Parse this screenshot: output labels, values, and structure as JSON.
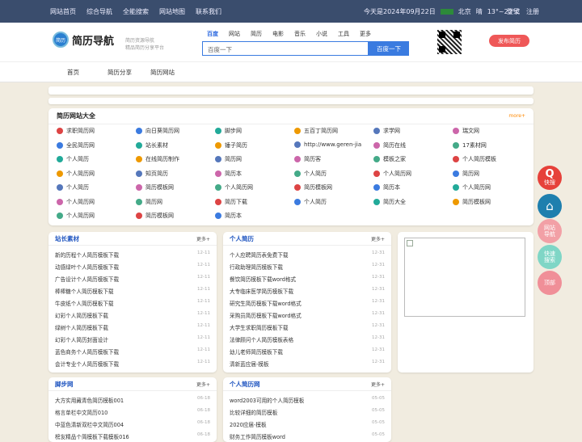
{
  "topbar": {
    "links": [
      "网站首页",
      "综合导航",
      "全能搜索",
      "网站地图",
      "联系我们"
    ],
    "date": "今天是2024年09月22日",
    "city": "北京",
    "weather": "晴",
    "temp": "13°~22°C",
    "login": "登录",
    "register": "注册"
  },
  "header": {
    "logo_icon": "简历",
    "logo_text": "简历导航",
    "slogan1": "简历资源导航",
    "slogan2": "精品简历分享平台",
    "tabs": [
      "百度",
      "网站",
      "简历",
      "电影",
      "音乐",
      "小说",
      "工具",
      "更多"
    ],
    "search_placeholder": "百度一下",
    "search_button": "百度一下",
    "publish": "发布简历"
  },
  "nav": [
    "首页",
    "简历分享",
    "简历网站"
  ],
  "panel": {
    "title": "简历网站大全",
    "more": "more+",
    "rows": [
      [
        "求职简历网",
        "向日葵简历网",
        "脚步网",
        "五百丁简历网",
        "求学网",
        "瑞文网"
      ],
      [
        "全民简历网",
        "站长素材",
        "锤子简历",
        "http://www.geren-jia",
        "简历在线",
        "17素材网"
      ],
      [
        "个人简历",
        "在线简历制作",
        "简历网",
        "简历客",
        "模板之家",
        "个人简历模板"
      ],
      [
        "个人简历网",
        "知页简历",
        "简历本",
        "个人简历",
        "个人简历网",
        "简历网"
      ],
      [
        "个人简历",
        "简历模板网",
        "个人简历网",
        "简历模板网",
        "简历本",
        "个人简历网"
      ],
      [
        "个人简历网",
        "简历网",
        "简历下载",
        "个人简历",
        "简历大全",
        "简历模板网"
      ],
      [
        "个人简历网",
        "简历模板网",
        "简历本"
      ]
    ]
  },
  "cards": {
    "c1": {
      "title": "站长素材",
      "more": "更多+",
      "items": [
        [
          "新的历程个人简历模板下载",
          "12-11"
        ],
        [
          "动感绿叶个人简历模板下载",
          "12-11"
        ],
        [
          "广告设计个人简历模板下载",
          "12-11"
        ],
        [
          "棒棒糖个人简历模板下载",
          "12-11"
        ],
        [
          "牛皮纸个人简历模板下载",
          "12-11"
        ],
        [
          "幻彩个人简历模板下载",
          "12-11"
        ],
        [
          "绿树个人简历模板下载",
          "12-11"
        ],
        [
          "幻彩个人简历封面设计",
          "12-11"
        ],
        [
          "蓝色商务个人简历模板下载",
          "12-11"
        ],
        [
          "会计专业个人简历模板下载",
          "12-11"
        ]
      ]
    },
    "c2": {
      "title": "个人简历",
      "more": "更多+",
      "items": [
        [
          "个人应聘简历表免费下载",
          "12-31"
        ],
        [
          "行政助理简历模板下载",
          "12-31"
        ],
        [
          "餐饮简历模板下载word格式",
          "12-31"
        ],
        [
          "大专临床医学简历模板下载",
          "12-31"
        ],
        [
          "研究生简历模板下载word格式",
          "12-31"
        ],
        [
          "采购员简历模板下载word格式",
          "12-31"
        ],
        [
          "大学生求职简历模板下载",
          "12-31"
        ],
        [
          "法律顾问个人简历模板表格",
          "12-31"
        ],
        [
          "幼儿老师简历模板下载",
          "12-31"
        ],
        [
          "清新蓝应届-模板",
          "12-31"
        ]
      ]
    },
    "c3": {
      "title": "脚步网",
      "more": "更多+",
      "items": [
        [
          "大方实用藏青色简历模板001",
          "06-18"
        ],
        [
          "格言单栏中文简历010",
          "06-18"
        ],
        [
          "中蓝色清新双栏中文简历004",
          "06-18"
        ],
        [
          "榜友精品个简模板下载模板016",
          "06-18"
        ]
      ]
    },
    "c4": {
      "title": "个人简历网",
      "more": "更多+",
      "items": [
        [
          "word2003可用的个人简历模板",
          "05-05"
        ],
        [
          "比较详细的简历模板",
          "05-05"
        ],
        [
          "2020应届-模板",
          "05-05"
        ],
        [
          "财务工作简历模板word",
          "05-05"
        ]
      ]
    }
  },
  "side": [
    {
      "label": "快搜",
      "color": "#e6413a"
    },
    {
      "label": "",
      "color": "#1e7fae"
    },
    {
      "label": "网站\n导航",
      "color": "#f2a0a6"
    },
    {
      "label": "快速\n搜索",
      "color": "#7fd6c6"
    },
    {
      "label": "顶部",
      "color": "#f08f98"
    }
  ]
}
